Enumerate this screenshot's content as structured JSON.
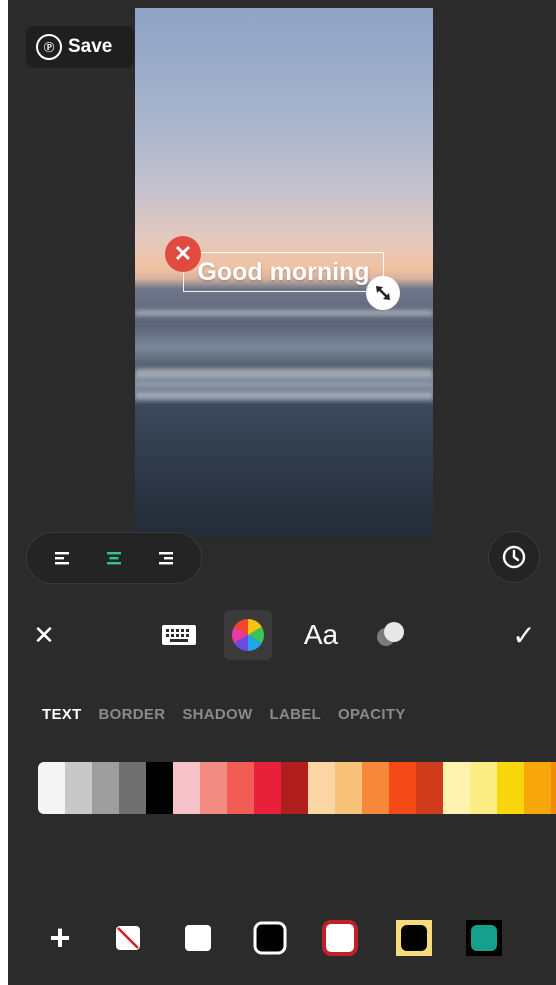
{
  "header": {
    "save_label": "Save",
    "save_icon_glyph": "℗"
  },
  "preview": {
    "text": "Good morning",
    "delete_glyph": "✕"
  },
  "align": {
    "options": [
      "left",
      "center",
      "right"
    ],
    "active": "center",
    "accent": "#2ec4a0"
  },
  "toolbar": {
    "close_glyph": "✕",
    "confirm_glyph": "✓",
    "font_label": "Aa",
    "tools": [
      "keyboard-icon",
      "color-wheel-icon",
      "font-icon",
      "eraser-icon"
    ]
  },
  "tabs": [
    {
      "label": "TEXT",
      "active": true
    },
    {
      "label": "BORDER",
      "active": false
    },
    {
      "label": "SHADOW",
      "active": false
    },
    {
      "label": "LABEL",
      "active": false
    },
    {
      "label": "OPACITY",
      "active": false
    }
  ],
  "palette": {
    "colors": [
      "#f4f4f4",
      "#c8c8c8",
      "#9e9e9e",
      "#707070",
      "#000000",
      "#f6c1c8",
      "#f28b82",
      "#f25c54",
      "#e8203a",
      "#b11e1e",
      "#fbd6a4",
      "#f9c27b",
      "#f7883a",
      "#f34a18",
      "#cf3b1b",
      "#fdf2b0",
      "#fbec83",
      "#f9d70c",
      "#f7a70c",
      "#f28a0c"
    ]
  },
  "styles": {
    "add_glyph": "+",
    "presets": [
      "none-style-icon",
      "white-fill-style-icon",
      "black-white-border-style-icon",
      "white-red-border-style-icon",
      "black-yellow-border-style-icon",
      "teal-black-border-style-icon"
    ]
  }
}
